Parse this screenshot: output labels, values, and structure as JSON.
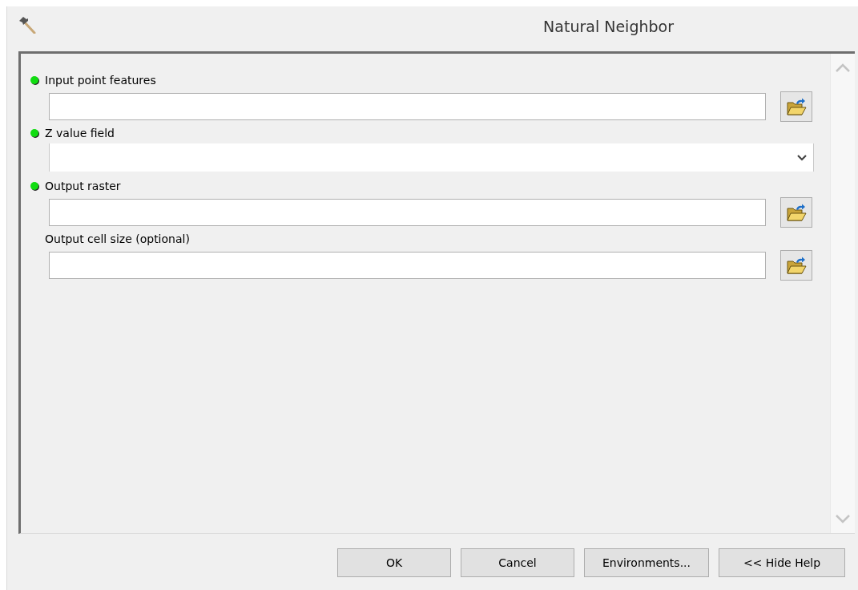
{
  "window": {
    "title": "Natural Neighbor"
  },
  "parameters": [
    {
      "label": "Input point features",
      "required": true,
      "kind": "browse"
    },
    {
      "label": "Z value field",
      "required": true,
      "kind": "dropdown"
    },
    {
      "label": "Output raster",
      "required": true,
      "kind": "browse"
    },
    {
      "label": "Output cell size (optional)",
      "required": false,
      "kind": "browse"
    }
  ],
  "buttons": [
    "OK",
    "Cancel",
    "Environments...",
    "<< Hide Help"
  ]
}
